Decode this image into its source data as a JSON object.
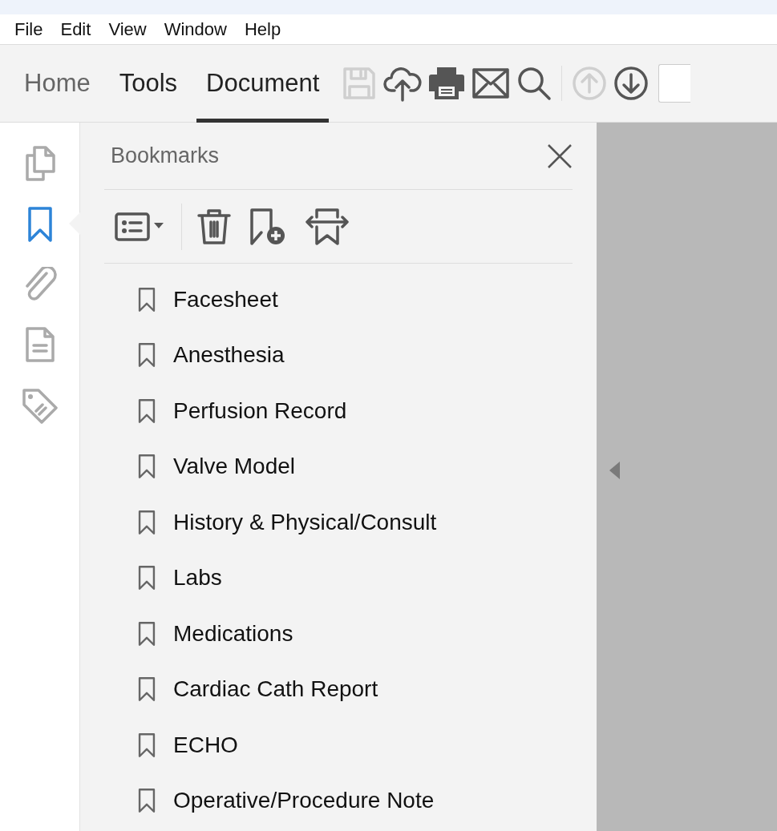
{
  "menu": [
    "File",
    "Edit",
    "View",
    "Window",
    "Help"
  ],
  "tabs": [
    {
      "label": "Home",
      "selected": false
    },
    {
      "label": "Tools",
      "selected": false
    },
    {
      "label": "Document",
      "selected": true
    }
  ],
  "toolbar": [
    {
      "kind": "save",
      "disabled": true
    },
    {
      "kind": "upload",
      "disabled": false
    },
    {
      "kind": "print",
      "disabled": false
    },
    {
      "kind": "mail",
      "disabled": false
    },
    {
      "kind": "search",
      "disabled": false
    },
    {
      "kind": "separator"
    },
    {
      "kind": "prev",
      "disabled": true
    },
    {
      "kind": "next",
      "disabled": false
    }
  ],
  "rail": [
    {
      "kind": "pages",
      "selected": false
    },
    {
      "kind": "bookmark",
      "selected": true
    },
    {
      "kind": "clip",
      "selected": false
    },
    {
      "kind": "doc",
      "selected": false
    },
    {
      "kind": "tag",
      "selected": false
    }
  ],
  "panel": {
    "title": "Bookmarks",
    "tools": [
      {
        "kind": "options"
      },
      {
        "kind": "separator"
      },
      {
        "kind": "delete"
      },
      {
        "kind": "add"
      },
      {
        "kind": "expand"
      }
    ],
    "bookmarks": [
      "Facesheet",
      "Anesthesia",
      "Perfusion Record",
      "Valve Model",
      "History & Physical/Consult",
      "Labs",
      "Medications",
      "Cardiac Cath Report",
      "ECHO",
      "Operative/Procedure Note"
    ]
  }
}
